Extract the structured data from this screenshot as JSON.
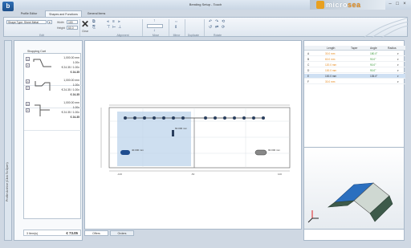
{
  "window": {
    "title": "Bending Setup - Touch",
    "app_button": "b",
    "controls": [
      "–",
      "□",
      "×"
    ]
  },
  "brand": {
    "name_a": "micro",
    "name_b": "sea"
  },
  "tabs": [
    "Profile Editor",
    "Shapes and Functions",
    "General Items"
  ],
  "ribbon": {
    "profile_label": "Shape Type: Sheet Metal",
    "width_label": "Width",
    "width_value": "100",
    "height_label": "Height",
    "height_value": "60.0",
    "clear_label": "Clear",
    "groups": [
      "Edit",
      "Alignment",
      "Move",
      "Mirror",
      "Duplicate",
      "Rotate"
    ]
  },
  "sidebar_tab": "Profile Archive (Click To Open)",
  "cart": {
    "title": "Shopping Cart",
    "items": [
      {
        "length": "1,000.00 mm",
        "qty": "1.00x",
        "unit": "€ 24.35 / 1.00x",
        "price": "€ 24.35"
      },
      {
        "length": "1,000.00 mm",
        "qty": "1.00x",
        "unit": "€ 24.35 / 1.00x",
        "price": "€ 24.35"
      },
      {
        "length": "1,000.00 mm",
        "qty": "1.00x",
        "unit": "€ 24.35 / 1.00x",
        "price": "€ 24.35"
      }
    ],
    "total_label": "3 Item(s)",
    "total_value": "€ 73.05"
  },
  "bottom_tabs": [
    "Offers",
    "Orders"
  ],
  "table": {
    "headers": [
      "",
      "Length",
      "Taper",
      "Angle",
      "Radius"
    ],
    "rows": [
      {
        "id": "A",
        "length": "30.0 mm",
        "angle": "180.0°"
      },
      {
        "id": "B",
        "length": "60.0 mm",
        "angle": "90.0°"
      },
      {
        "id": "C",
        "length": "120.0 mm",
        "angle": "90.0°"
      },
      {
        "id": "D",
        "length": "100.0 mm",
        "angle": "90.0°"
      },
      {
        "id": "E",
        "length": "100.0 mm",
        "angle": "135.0°"
      },
      {
        "id": "F",
        "length": "30.0 mm",
        "angle": ""
      }
    ]
  },
  "drawing": {
    "label_a": "40.000 mm",
    "label_b": "90.000 mm",
    "label_c": "60.000 mm",
    "axis_start": "-100",
    "axis_mid": "-50",
    "axis_end": "100"
  },
  "colors": {
    "accent": "#2f6fb5",
    "orange": "#e58a1f",
    "green": "#3a9a3a",
    "panel3d": "#2b6fbf"
  }
}
